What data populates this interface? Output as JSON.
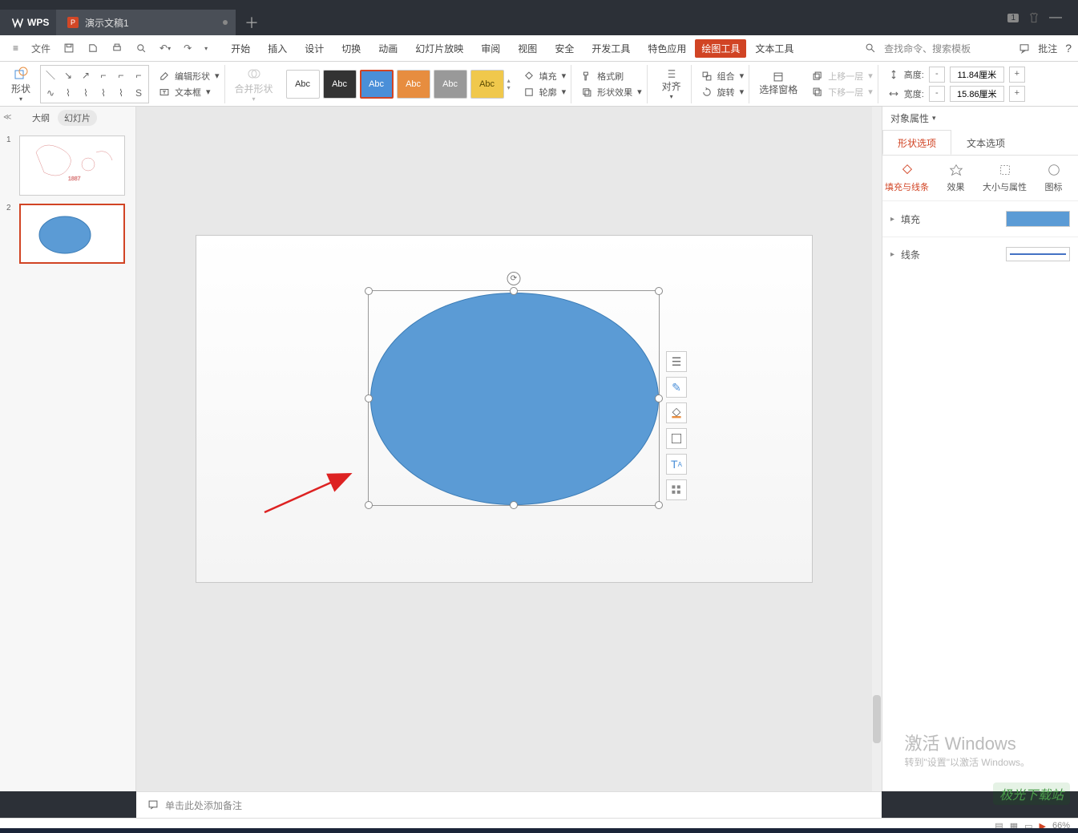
{
  "titlebar": {
    "app_name": "WPS",
    "doc_name": "演示文稿1",
    "badge": "1"
  },
  "menubar": {
    "file": "文件",
    "items": [
      "开始",
      "插入",
      "设计",
      "切换",
      "动画",
      "幻灯片放映",
      "审阅",
      "视图",
      "安全",
      "开发工具",
      "特色应用",
      "绘图工具",
      "文本工具"
    ],
    "active_index": 11,
    "search_hint": "查找命令、搜索模板",
    "annotate": "批注"
  },
  "toolbar": {
    "shape": "形状",
    "edit_shape": "编辑形状",
    "textbox": "文本框",
    "merge_shapes": "合并形状",
    "abc": "Abc",
    "fill": "填充",
    "outline": "轮廓",
    "format_painter": "格式刷",
    "shape_effects": "形状效果",
    "align": "对齐",
    "group": "组合",
    "rotate": "旋转",
    "selection_pane": "选择窗格",
    "bring_forward": "上移一层",
    "send_backward": "下移一层",
    "height_label": "高度:",
    "width_label": "宽度:",
    "height_value": "11.84厘米",
    "width_value": "15.86厘米"
  },
  "leftpanel": {
    "tab_outline": "大纲",
    "tab_slides": "幻灯片",
    "slides": [
      {
        "n": "1"
      },
      {
        "n": "2"
      }
    ]
  },
  "rightpanel": {
    "title": "对象属性",
    "tab_shape": "形状选项",
    "tab_text": "文本选项",
    "sub_fill_line": "填充与线条",
    "sub_effect": "效果",
    "sub_size": "大小与属性",
    "sub_icon": "图标",
    "fill": "填充",
    "line": "线条"
  },
  "notes": {
    "placeholder": "单击此处添加备注"
  },
  "statusbar": {
    "zoom": "66%"
  },
  "watermark": {
    "title": "激活 Windows",
    "subtitle": "转到\"设置\"以激活 Windows。"
  },
  "site_mark": "极光下载站"
}
